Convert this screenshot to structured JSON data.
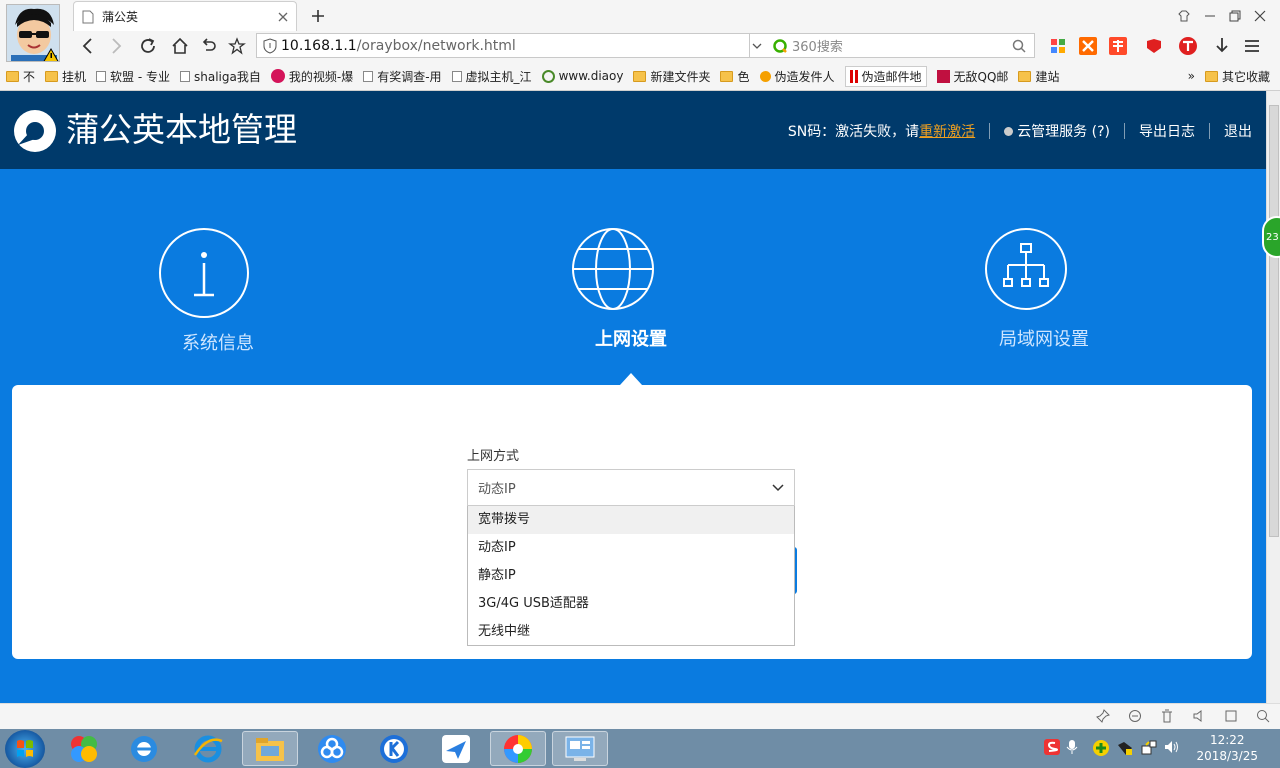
{
  "browser": {
    "tab_title": "蒲公英",
    "url_host": "10.168.1.1",
    "url_path": "/oraybox/network.html",
    "search_placeholder": "360搜索",
    "bookmarks": [
      {
        "label": "不",
        "icon": "folder"
      },
      {
        "label": "挂机",
        "icon": "folder"
      },
      {
        "label": "软盟 - 专业",
        "icon": "page"
      },
      {
        "label": "shaliga我自",
        "icon": "page"
      },
      {
        "label": "我的视频-爆",
        "icon": "video"
      },
      {
        "label": "有奖调查-用",
        "icon": "page"
      },
      {
        "label": "虚拟主机_江",
        "icon": "page"
      },
      {
        "label": "www.diaoy",
        "icon": "page"
      },
      {
        "label": "新建文件夹",
        "icon": "folder"
      },
      {
        "label": "色",
        "icon": "folder"
      },
      {
        "label": "伪造发件人",
        "icon": "page"
      },
      {
        "label": "伪造邮件地",
        "icon": "page"
      },
      {
        "label": "无敌QQ邮",
        "icon": "page"
      },
      {
        "label": "建站",
        "icon": "folder"
      }
    ],
    "bookmarks_more": "»",
    "other_bookmarks": "其它收藏"
  },
  "header": {
    "brand": "蒲公英本地管理",
    "sn_text": "SN码：激活失败，请",
    "reactivate": "重新激活",
    "cloud": "云管理服务 (?)",
    "export_log": "导出日志",
    "logout": "退出"
  },
  "nav": [
    {
      "label": "系统信息",
      "icon": "info-icon"
    },
    {
      "label": "上网设置",
      "icon": "globe-icon"
    },
    {
      "label": "局域网设置",
      "icon": "network-icon"
    }
  ],
  "form": {
    "label": "上网方式",
    "selected": "动态IP",
    "options": [
      "宽带拨号",
      "动态IP",
      "静态IP",
      "3G/4G USB适配器",
      "无线中继"
    ]
  },
  "side_badge": "23",
  "clock": {
    "time": "12:22",
    "date": "2018/3/25"
  },
  "colors": {
    "header": "#003a6b",
    "page": "#0a7be0",
    "accent": "#f0a020"
  }
}
